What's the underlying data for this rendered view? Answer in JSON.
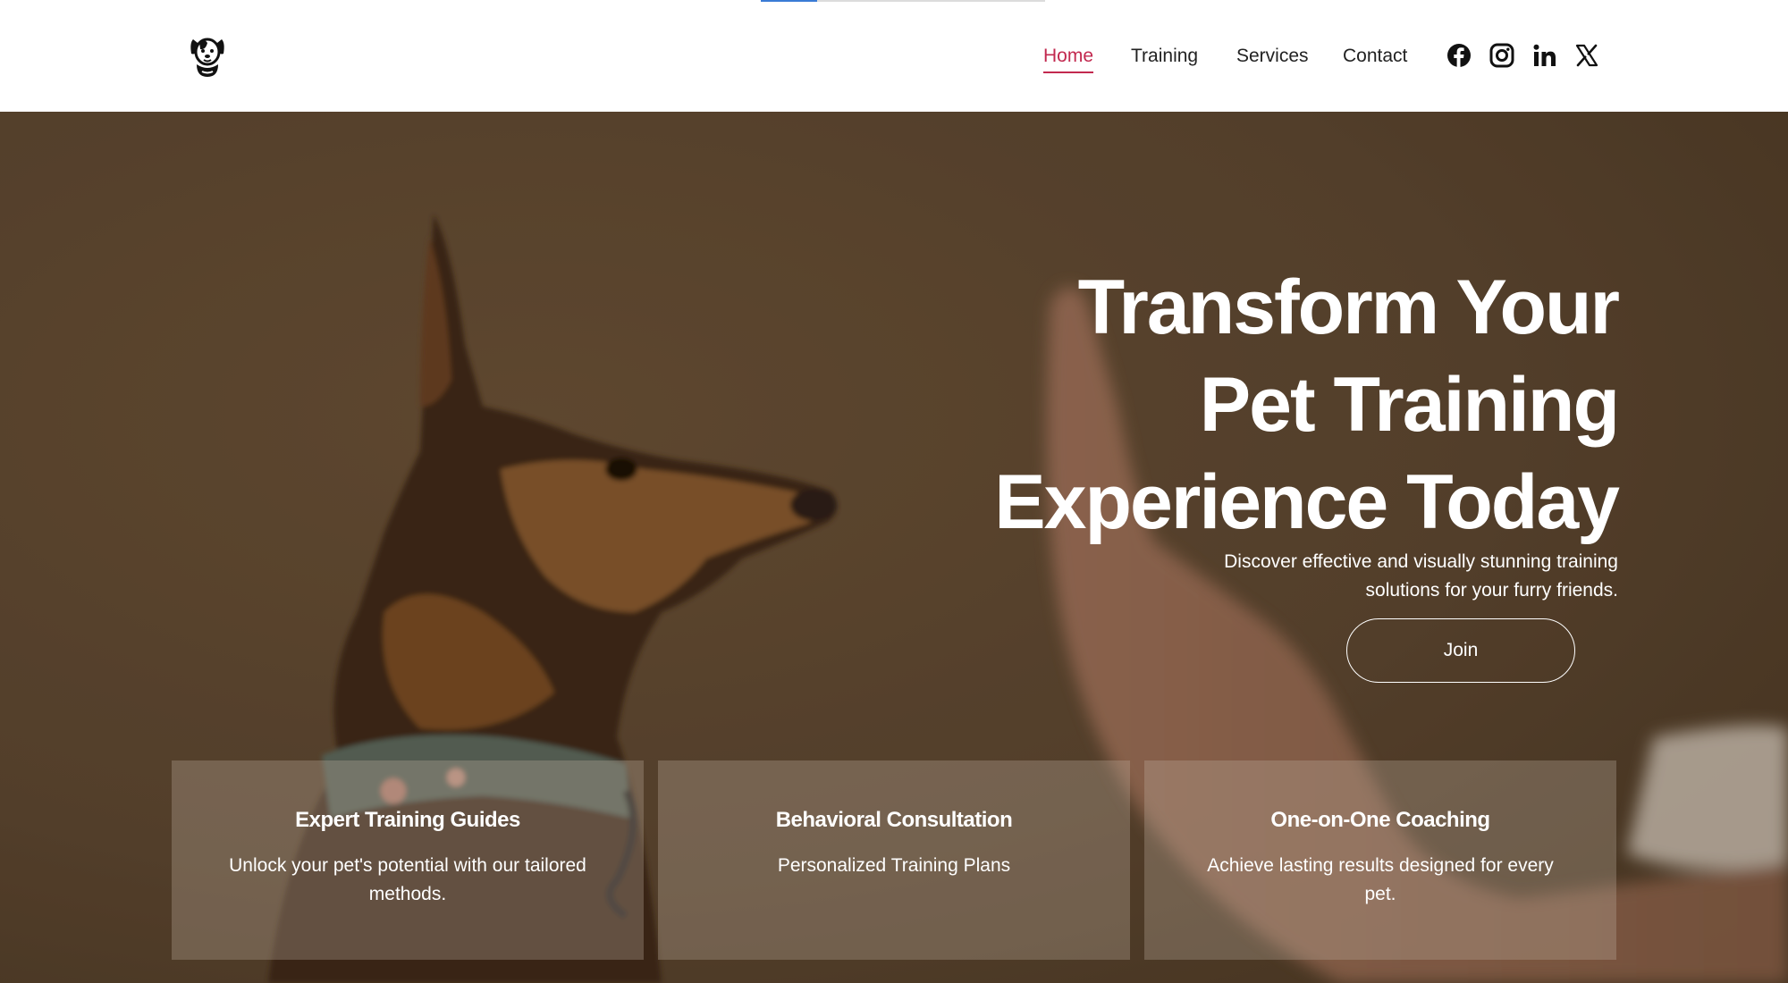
{
  "header": {
    "logo_icon": "dog-head-logo-icon",
    "nav": [
      {
        "label": "Home",
        "active": true
      },
      {
        "label": "Training",
        "active": false
      },
      {
        "label": "Services",
        "active": false
      },
      {
        "label": "Contact",
        "active": false
      }
    ],
    "social_icons": [
      "facebook-icon",
      "instagram-icon",
      "linkedin-icon",
      "x-twitter-icon"
    ],
    "accent_color": "#c2294f"
  },
  "hero": {
    "title_lines": [
      "Transform Your",
      "Pet Training",
      "Experience Today"
    ],
    "subtitle": "Discover effective and visually stunning training solutions for your furry friends.",
    "cta_label": "Join"
  },
  "cards": [
    {
      "title": "Expert Training Guides",
      "text": "Unlock your pet's potential with our tailored methods."
    },
    {
      "title": "Behavioral Consultation",
      "text": "Personalized Training Plans"
    },
    {
      "title": "One-on-One Coaching",
      "text": "Achieve lasting results designed for every pet."
    }
  ]
}
